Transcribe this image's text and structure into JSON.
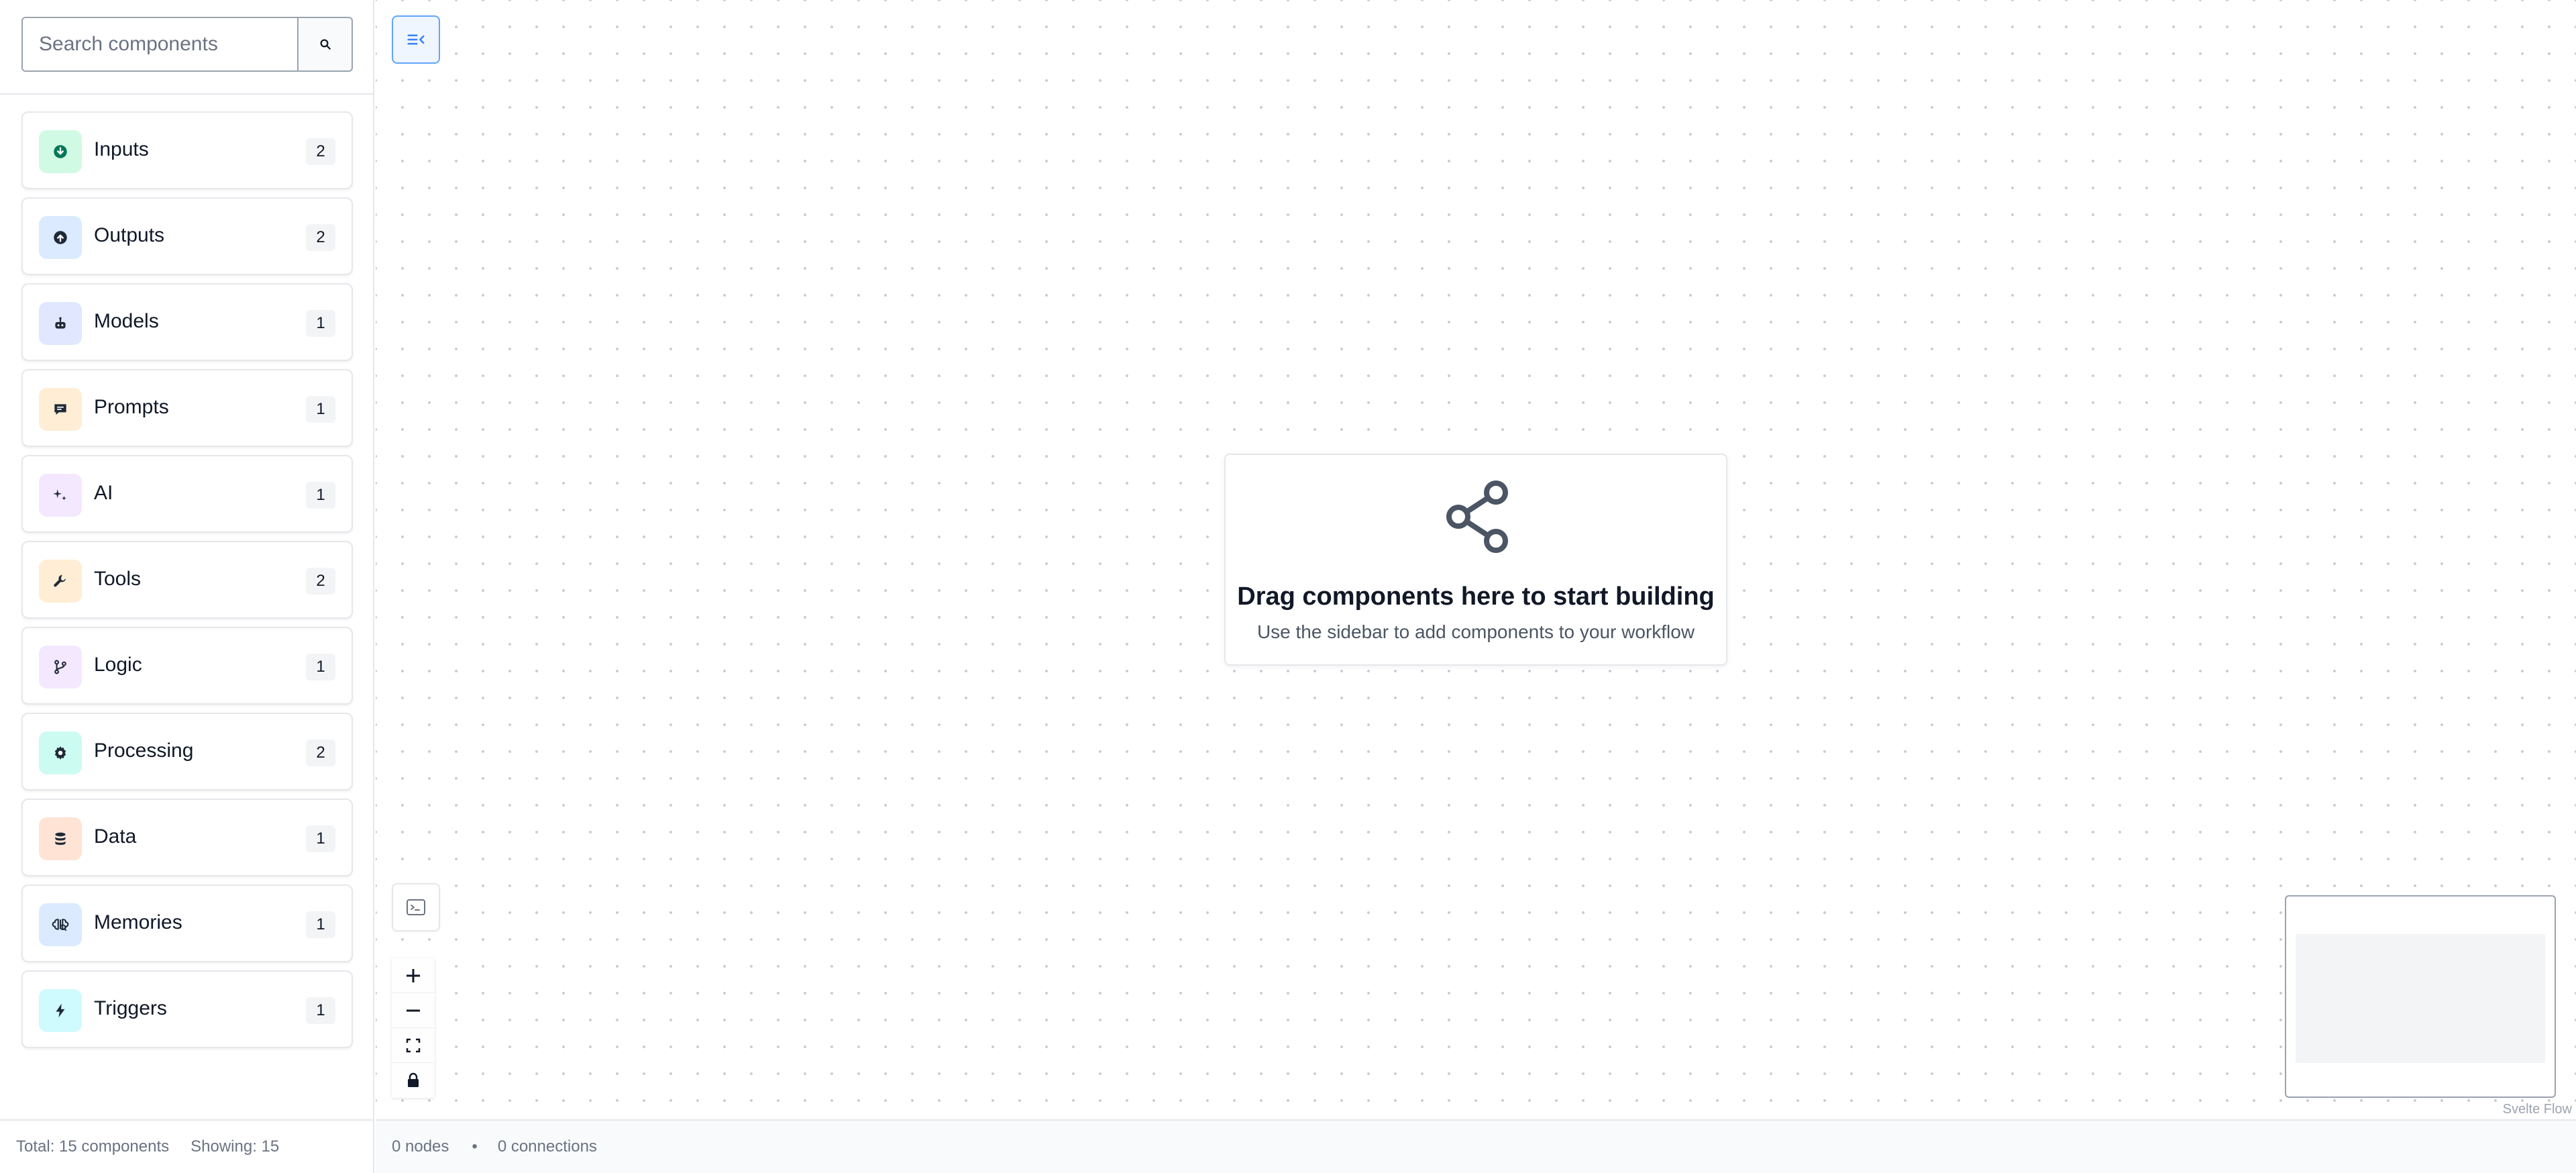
{
  "search": {
    "placeholder": "Search components"
  },
  "categories": [
    {
      "label": "Inputs",
      "count": "2",
      "icon": "arrow-down-circle-icon",
      "bg": "#d1fae5",
      "fg": "#047857"
    },
    {
      "label": "Outputs",
      "count": "2",
      "icon": "arrow-up-circle-icon",
      "bg": "#dbeafe",
      "fg": "#1f2937"
    },
    {
      "label": "Models",
      "count": "1",
      "icon": "robot-icon",
      "bg": "#e0e7ff",
      "fg": "#1f2937"
    },
    {
      "label": "Prompts",
      "count": "1",
      "icon": "chat-icon",
      "bg": "#ffedd5",
      "fg": "#1f2937"
    },
    {
      "label": "AI",
      "count": "1",
      "icon": "sparkles-icon",
      "bg": "#f3e8ff",
      "fg": "#1f2937"
    },
    {
      "label": "Tools",
      "count": "2",
      "icon": "wrench-icon",
      "bg": "#ffedd5",
      "fg": "#1f2937"
    },
    {
      "label": "Logic",
      "count": "1",
      "icon": "git-branch-icon",
      "bg": "#f3e8ff",
      "fg": "#1f2937"
    },
    {
      "label": "Processing",
      "count": "2",
      "icon": "gear-icon",
      "bg": "#ccfbf1",
      "fg": "#1f2937"
    },
    {
      "label": "Data",
      "count": "1",
      "icon": "database-icon",
      "bg": "#ffe4d6",
      "fg": "#1f2937"
    },
    {
      "label": "Memories",
      "count": "1",
      "icon": "brain-icon",
      "bg": "#dbeafe",
      "fg": "#1f2937"
    },
    {
      "label": "Triggers",
      "count": "1",
      "icon": "lightning-icon",
      "bg": "#cffafe",
      "fg": "#1f2937"
    }
  ],
  "sidebar_footer": {
    "total": "Total: 15 components",
    "showing": "Showing: 15"
  },
  "canvas": {
    "empty_title": "Drag components here to start building",
    "empty_subtitle": "Use the sidebar to add components to your workflow",
    "attribution": "Svelte Flow"
  },
  "status_bar": {
    "nodes": "0 nodes",
    "separator": "•",
    "connections": "0 connections"
  },
  "colors": {
    "accent": "#3b82f6",
    "toggle_bg": "#eff6ff"
  }
}
